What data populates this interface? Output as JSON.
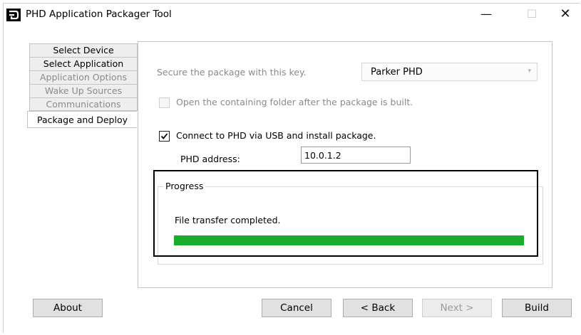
{
  "window": {
    "title": "PHD Application Packager Tool",
    "controls": {
      "minimize": "—",
      "maximize": "☐",
      "close": "✕"
    }
  },
  "sidebar": {
    "items": [
      {
        "label": "Select Device",
        "state": "normal"
      },
      {
        "label": "Select Application",
        "state": "normal"
      },
      {
        "label": "Application Options",
        "state": "disabled"
      },
      {
        "label": "Wake Up Sources",
        "state": "disabled"
      },
      {
        "label": "Communications",
        "state": "disabled"
      },
      {
        "label": "Package and Deploy",
        "state": "active"
      }
    ]
  },
  "main": {
    "key_label": "Secure the package with this key.",
    "key_select": {
      "value": "Parker PHD",
      "chevron": "⌄"
    },
    "open_folder": {
      "label": "Open the containing folder after the package is built.",
      "checked": false,
      "enabled": false
    },
    "connect_usb": {
      "label": "Connect to PHD via USB and install package.",
      "checked": true
    },
    "phd_address": {
      "label": "PHD address:",
      "value": "10.0.1.2"
    },
    "progress": {
      "legend": "Progress",
      "status": "File transfer completed.",
      "percent": 100,
      "color": "#1aad2b"
    }
  },
  "buttons": {
    "about": "About",
    "cancel": "Cancel",
    "back": "< Back",
    "next": "Next >",
    "build": "Build"
  },
  "icons": {
    "app": "phd-logo-icon",
    "check": "checkmark-icon"
  },
  "colors": {
    "progress_fill": "#1aad2b",
    "tab_bg": "#eeeeee",
    "disabled_text": "#8a8a8a"
  }
}
